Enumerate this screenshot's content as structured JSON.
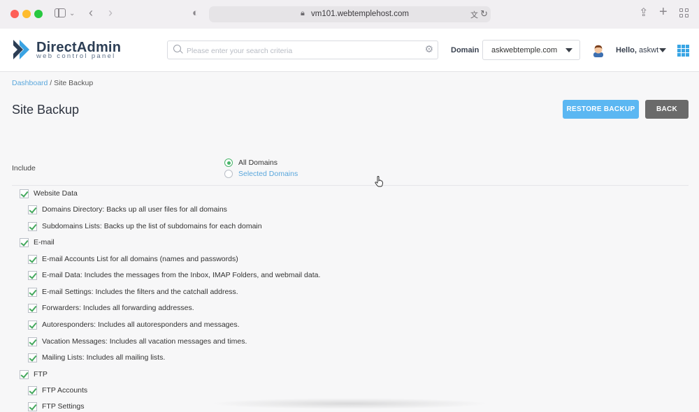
{
  "browser": {
    "url": "vm101.webtemplehost.com"
  },
  "header": {
    "brand_name": "DirectAdmin",
    "brand_tagline": "web control panel",
    "search_placeholder": "Please enter your search criteria",
    "domain_label": "Domain",
    "domain_value": "askwebtemple.com",
    "greeting": "Hello,",
    "username": "askwt"
  },
  "breadcrumb": {
    "link": "Dashboard",
    "separator": " / ",
    "current": "Site Backup"
  },
  "page": {
    "title": "Site Backup",
    "restore_button": "RESTORE BACKUP",
    "back_button": "BACK"
  },
  "include": {
    "label": "Include",
    "options": [
      {
        "label": "All Domains",
        "selected": true
      },
      {
        "label": "Selected Domains",
        "selected": false
      }
    ]
  },
  "sections": [
    {
      "label": "Website Data",
      "checked": true,
      "items": [
        {
          "label": "Domains Directory: Backs up all user files for all domains",
          "checked": true
        },
        {
          "label": "Subdomains Lists: Backs up the list of subdomains for each domain",
          "checked": true
        }
      ]
    },
    {
      "label": "E-mail",
      "checked": true,
      "items": [
        {
          "label": "E-mail Accounts List for all domains (names and passwords)",
          "checked": true
        },
        {
          "label": "E-mail Data: Includes the messages from the Inbox, IMAP Folders, and webmail data.",
          "checked": true
        },
        {
          "label": "E-mail Settings: Includes the filters and the catchall address.",
          "checked": true
        },
        {
          "label": "Forwarders: Includes all forwarding addresses.",
          "checked": true
        },
        {
          "label": "Autoresponders: Includes all autoresponders and messages.",
          "checked": true
        },
        {
          "label": "Vacation Messages: Includes all vacation messages and times.",
          "checked": true
        },
        {
          "label": "Mailing Lists: Includes all mailing lists.",
          "checked": true
        }
      ]
    },
    {
      "label": "FTP",
      "checked": true,
      "items": [
        {
          "label": "FTP Accounts",
          "checked": true
        },
        {
          "label": "FTP Settings",
          "checked": true
        }
      ]
    }
  ],
  "colors": {
    "accent_blue": "#5bb7f2",
    "check_green": "#44a85d",
    "back_gray": "#6a6a6a",
    "link_blue": "#5aa7dc"
  }
}
